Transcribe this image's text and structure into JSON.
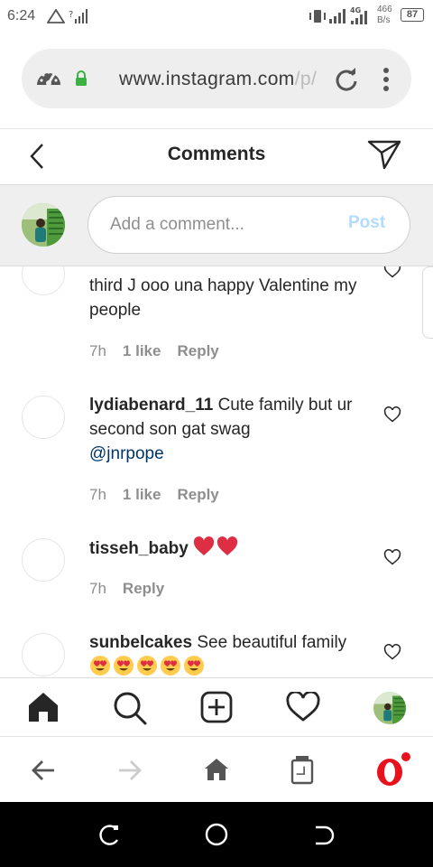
{
  "status_bar": {
    "time": "6:24",
    "network_speed_value": "466",
    "network_speed_unit": "B/s",
    "battery": "87"
  },
  "browser": {
    "url_main": "www.instagram.com",
    "url_fade": "/p/"
  },
  "header": {
    "title": "Comments"
  },
  "compose": {
    "placeholder": "Add a comment...",
    "post_label": "Post"
  },
  "comments": [
    {
      "username": "",
      "text": "third J ooo una happy Valentine my people",
      "mention": "",
      "emoji_count": 0,
      "emoji": "",
      "time": "7h",
      "likes": "1 like",
      "reply": "Reply"
    },
    {
      "username": "lydiabenard_11",
      "text": "Cute family but ur second son gat swag",
      "mention": "@jnrpope",
      "emoji_count": 0,
      "emoji": "",
      "time": "7h",
      "likes": "1 like",
      "reply": "Reply"
    },
    {
      "username": "tisseh_baby",
      "text": "",
      "mention": "",
      "emoji_count": 2,
      "emoji": "red-heart",
      "time": "7h",
      "likes": "",
      "reply": "Reply"
    },
    {
      "username": "sunbelcakes",
      "text": "See beautiful family",
      "mention": "",
      "emoji_count": 5,
      "emoji": "heart-eyes",
      "time": "",
      "likes": "",
      "reply": ""
    }
  ],
  "bottom_nav": {
    "items": [
      "home-icon",
      "search-icon",
      "new-post-icon",
      "activity-icon",
      "profile-avatar"
    ]
  },
  "browser_toolbar": {
    "items": [
      "back-arrow-icon",
      "forward-arrow-icon",
      "home-icon",
      "tabs-icon",
      "opera-menu-icon"
    ]
  },
  "colors": {
    "text": "#262626",
    "secondary": "#8e8e8e",
    "post_disabled": "#b3dbff",
    "mention": "#003569",
    "heart_red": "#e0245e",
    "opera_red": "#e8121e"
  }
}
